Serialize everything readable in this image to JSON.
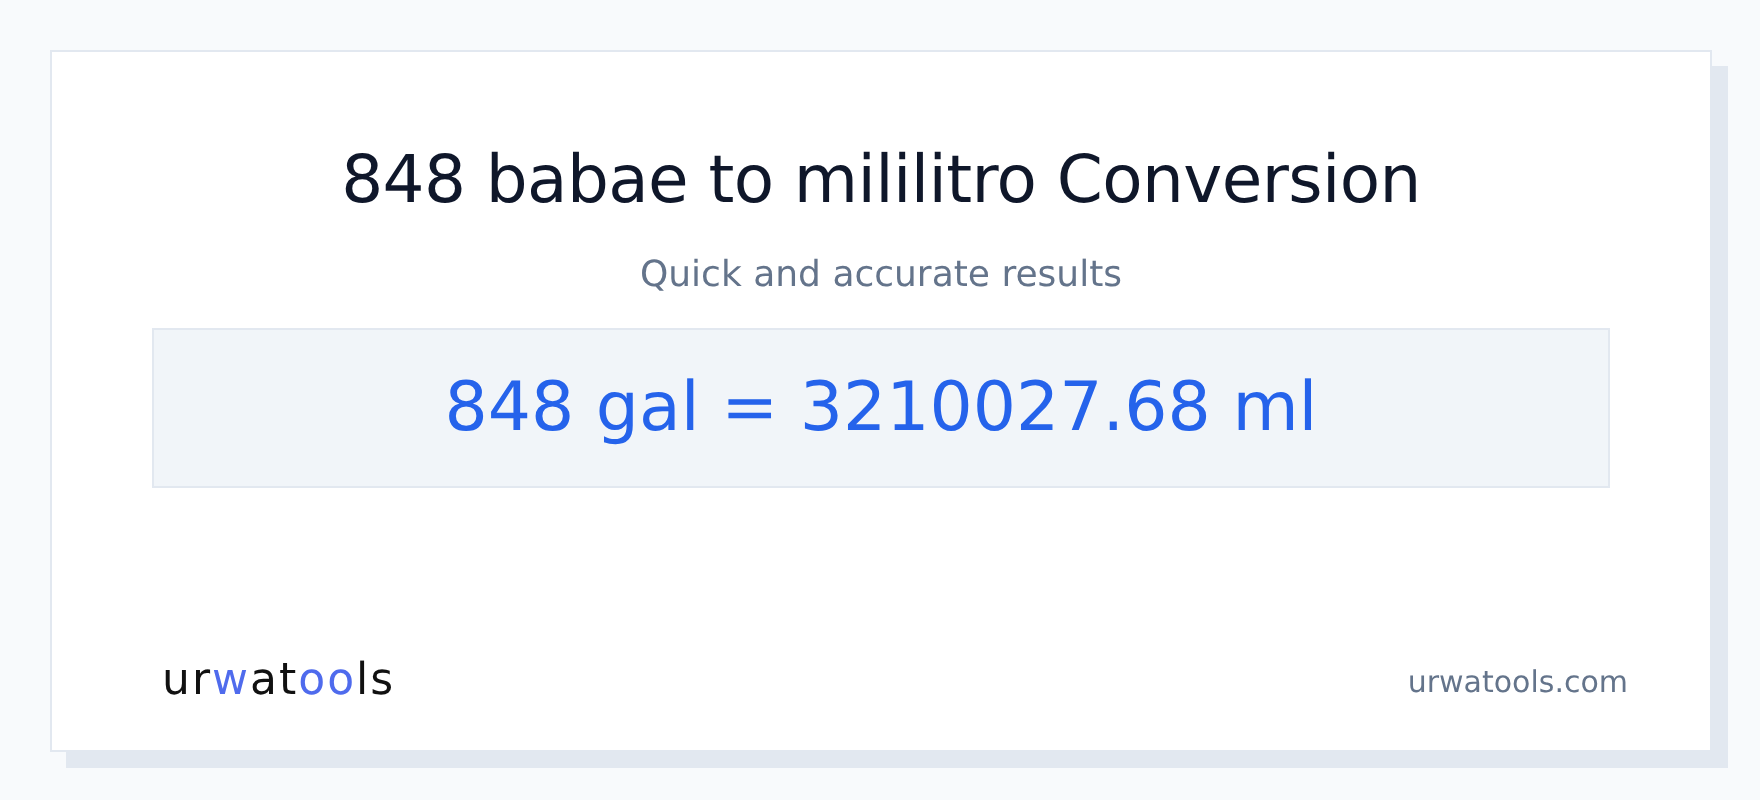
{
  "title": "848 babae to mililitro Conversion",
  "subtitle": "Quick and accurate results",
  "result": "848 gal = 3210027.68 ml",
  "logo": [
    {
      "text": "ur",
      "accent": false
    },
    {
      "text": "w",
      "accent": true
    },
    {
      "text": "at",
      "accent": false
    },
    {
      "text": "oo",
      "accent": true
    },
    {
      "text": "ls",
      "accent": false
    }
  ],
  "site": "urwatools.com"
}
